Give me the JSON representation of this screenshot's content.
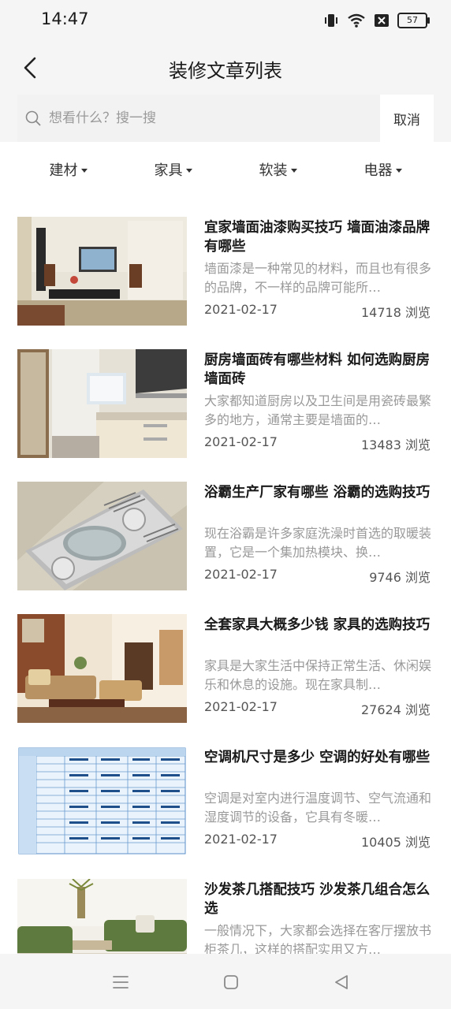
{
  "status_bar": {
    "time": "14:47",
    "battery": "57"
  },
  "header": {
    "title": "装修文章列表"
  },
  "search": {
    "placeholder": "想看什么？搜一搜",
    "cancel_label": "取消"
  },
  "filters": [
    {
      "label": "建材"
    },
    {
      "label": "家具"
    },
    {
      "label": "软装"
    },
    {
      "label": "电器"
    }
  ],
  "articles": [
    {
      "title": "宜家墙面油漆购买技巧 墙面油漆品牌有哪些",
      "summary": "墙面漆是一种常见的材料，而且也有很多的品牌，不一样的品牌可能所…",
      "date": "2021-02-17",
      "views": "14718 浏览"
    },
    {
      "title": "厨房墙面砖有哪些材料 如何选购厨房墙面砖",
      "summary": "大家都知道厨房以及卫生间是用瓷砖最繁多的地方，通常主要是墙面的…",
      "date": "2021-02-17",
      "views": "13483 浏览"
    },
    {
      "title": "浴霸生产厂家有哪些 浴霸的选购技巧",
      "summary": "现在浴霸是许多家庭洗澡时首选的取暖装置，它是一个集加热模块、换…",
      "date": "2021-02-17",
      "views": "9746 浏览"
    },
    {
      "title": "全套家具大概多少钱 家具的选购技巧",
      "summary": "家具是大家生活中保持正常生活、休闲娱乐和休息的设施。现在家具制…",
      "date": "2021-02-17",
      "views": "27624 浏览"
    },
    {
      "title": "空调机尺寸是多少 空调的好处有哪些",
      "summary": "空调是对室内进行温度调节、空气流通和湿度调节的设备，它具有冬暖…",
      "date": "2021-02-17",
      "views": "10405 浏览"
    },
    {
      "title": "沙发茶几搭配技巧 沙发茶几组合怎么选",
      "summary": "一般情况下，大家都会选择在客厅摆放书柜茶几，这样的搭配实用又方…",
      "date": "",
      "views": ""
    }
  ]
}
